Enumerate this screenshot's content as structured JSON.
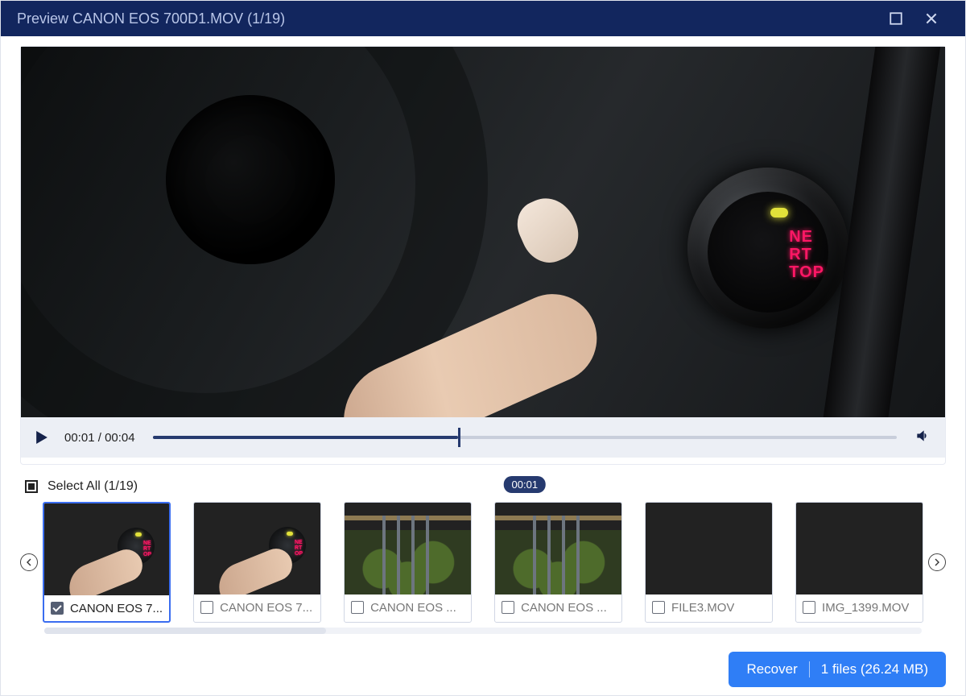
{
  "titlebar": {
    "title": "Preview CANON EOS 700D1.MOV (1/19)"
  },
  "player": {
    "current": "00:01",
    "duration": "00:04",
    "tooltip": "00:01",
    "button_text": {
      "l1": "NE",
      "l2": "RT",
      "l3": "TOP"
    }
  },
  "select_all": {
    "label": "Select All",
    "count": "(1/19)"
  },
  "thumbs": [
    {
      "name": "CANON EOS 7...",
      "kind": "dark",
      "selected": true
    },
    {
      "name": "CANON EOS 7...",
      "kind": "dark",
      "selected": false
    },
    {
      "name": "CANON EOS ...",
      "kind": "porch",
      "selected": false
    },
    {
      "name": "CANON EOS ...",
      "kind": "porch",
      "selected": false
    },
    {
      "name": "FILE3.MOV",
      "kind": "ceiling",
      "selected": false
    },
    {
      "name": "IMG_1399.MOV",
      "kind": "ceiling",
      "selected": false
    }
  ],
  "recover": {
    "action": "Recover",
    "summary": "1 files (26.24 MB)"
  }
}
